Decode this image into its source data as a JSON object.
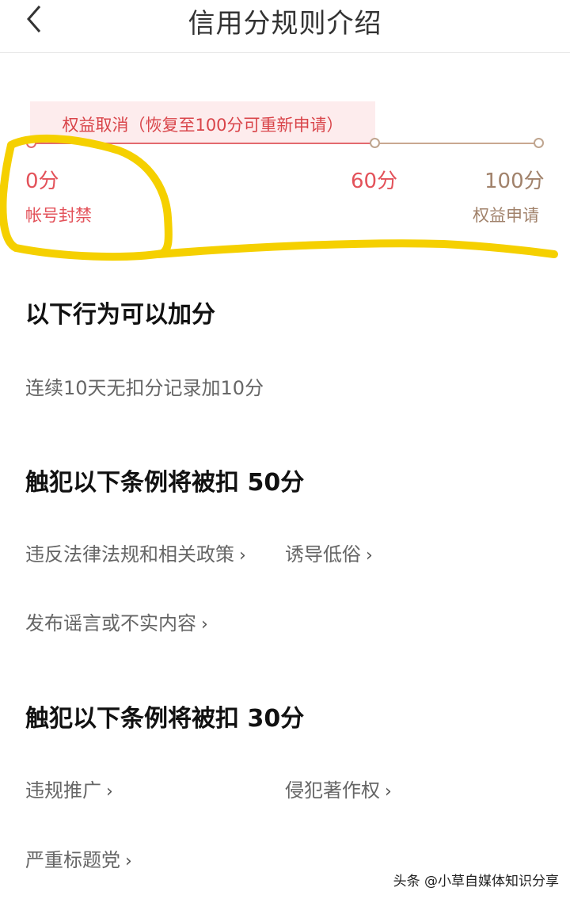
{
  "header": {
    "title": "信用分规则介绍"
  },
  "scale": {
    "banner": "权益取消（恢复至100分可重新申请）",
    "points": [
      {
        "value": "0分",
        "label": "帐号封禁"
      },
      {
        "value": "60分",
        "label": ""
      },
      {
        "value": "100分",
        "label": "权益申请"
      }
    ],
    "colors": {
      "accent": "#e3525a",
      "secondary": "#a1826b",
      "highlight": "#f5d000"
    }
  },
  "sections": [
    {
      "title": "以下行为可以加分",
      "items": [
        "连续10天无扣分记录加10分"
      ]
    },
    {
      "title": "触犯以下条例将被扣 50分",
      "items": [
        "违反法律法规和相关政策",
        "诱导低俗",
        "发布谣言或不实内容"
      ]
    },
    {
      "title": "触犯以下条例将被扣 30分",
      "items": [
        "违规推广",
        "侵犯著作权",
        "严重标题党"
      ]
    }
  ],
  "watermark": "头条 @小草自媒体知识分享",
  "icons": {
    "back": "chevron-left-icon",
    "link": "chevron-right-icon"
  }
}
